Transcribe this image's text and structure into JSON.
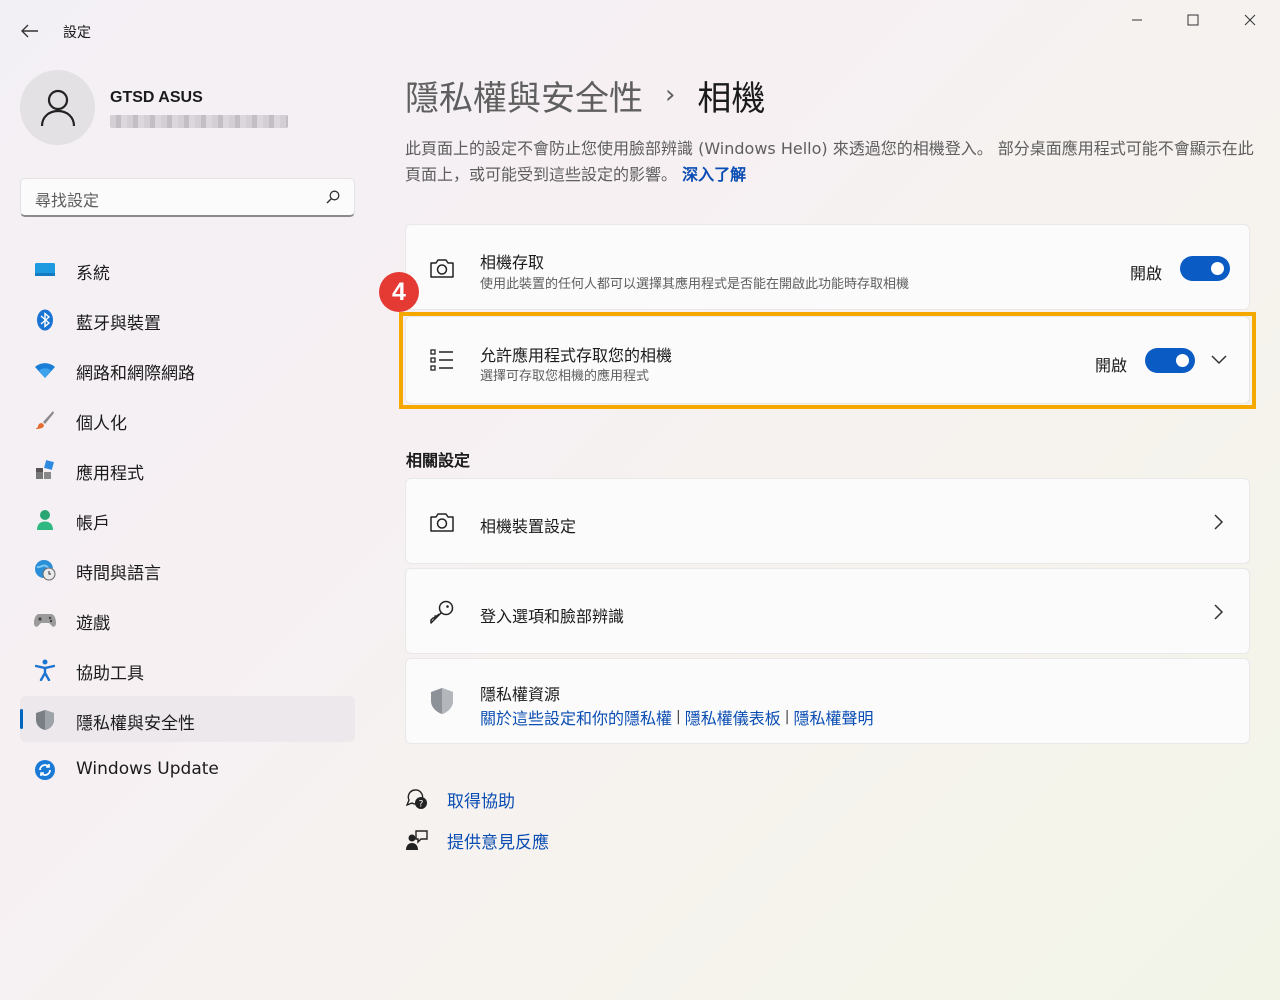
{
  "window": {
    "title": "設定",
    "back_label": "←",
    "min_label": "—",
    "max_label": "□",
    "close_label": "✕"
  },
  "profile": {
    "name": "GTSD ASUS"
  },
  "search": {
    "placeholder": "尋找設定"
  },
  "sidebar": {
    "items": [
      {
        "label": "系統",
        "icon": "system-icon"
      },
      {
        "label": "藍牙與裝置",
        "icon": "bluetooth-icon"
      },
      {
        "label": "網路和網際網路",
        "icon": "wifi-icon"
      },
      {
        "label": "個人化",
        "icon": "brush-icon"
      },
      {
        "label": "應用程式",
        "icon": "apps-icon"
      },
      {
        "label": "帳戶",
        "icon": "account-icon"
      },
      {
        "label": "時間與語言",
        "icon": "globe-clock-icon"
      },
      {
        "label": "遊戲",
        "icon": "gamepad-icon"
      },
      {
        "label": "協助工具",
        "icon": "accessibility-icon"
      },
      {
        "label": "隱私權與安全性",
        "icon": "shield-icon",
        "active": true
      },
      {
        "label": "Windows Update",
        "icon": "update-icon"
      }
    ]
  },
  "page": {
    "breadcrumb_parent": "隱私權與安全性",
    "breadcrumb_sep": "›",
    "breadcrumb_current": "相機",
    "description": "此頁面上的設定不會防止您使用臉部辨識 (Windows Hello) 來透過您的相機登入。 部分桌面應用程式可能不會顯示在此頁面上，或可能受到這些設定的影響。",
    "learn_more": "深入了解"
  },
  "camera_access": {
    "title": "相機存取",
    "subtitle": "使用此裝置的任何人都可以選擇其應用程式是否能在開啟此功能時存取相機",
    "toggle_label": "開啟",
    "toggle_on": true
  },
  "app_access": {
    "title": "允許應用程式存取您的相機",
    "subtitle": "選擇可存取您相機的應用程式",
    "toggle_label": "開啟",
    "toggle_on": true
  },
  "annotation": {
    "step": "4",
    "highlight_color": "#f5a800",
    "badge_color": "#e53a33"
  },
  "related": {
    "heading": "相關設定",
    "camera_device": "相機裝置設定",
    "sign_in": "登入選項和臉部辨識",
    "privacy_title": "隱私權資源",
    "privacy_links": [
      "關於這些設定和你的隱私權",
      "隱私權儀表板",
      "隱私權聲明"
    ],
    "link_sep": "|"
  },
  "help": {
    "get_help": "取得協助",
    "feedback": "提供意見反應"
  },
  "colors": {
    "accent": "#0a5bc4",
    "link": "#0a4db3"
  }
}
